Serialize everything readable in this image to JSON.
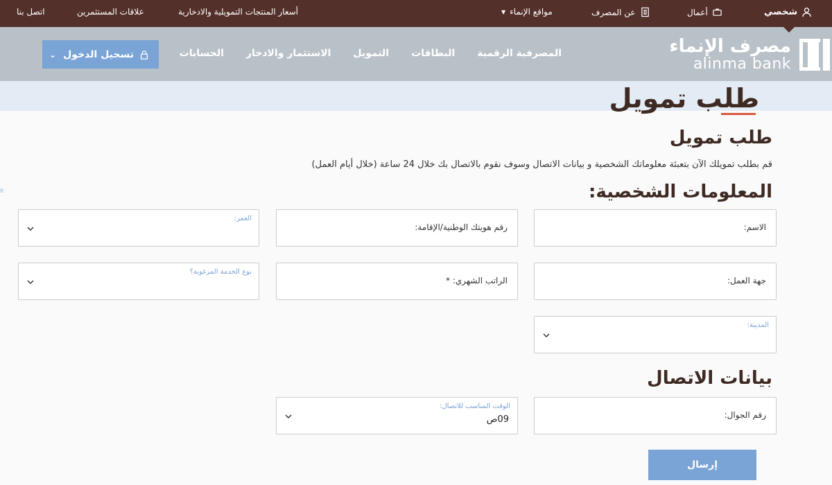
{
  "topbar": {
    "personal": "شخصي",
    "business": "أعمال",
    "about": "عن المصرف",
    "locations": "مواقع الإنماء",
    "prices": "أسعار المنتجات التمويلية والادخارية",
    "investors": "علاقات المستثمرين",
    "contact": "اتصل بنا"
  },
  "logo": {
    "arabic": "مصرف الإنماء",
    "english": "alinma bank"
  },
  "nav": {
    "accounts": "الحسابات",
    "investment": "الاستثمار والادخار",
    "financing": "التمويل",
    "cards": "البطاقات",
    "digital": "المصرفية الرقمية"
  },
  "login": {
    "label": "تسجيل الدخول"
  },
  "page": {
    "title": "طلب تمويل",
    "section_title": "طلب تمويل",
    "intro": "قم بطلب تمويلك الآن بتعبئة معلوماتك الشخصية و بيانات الاتصال وسوف نقوم بالاتصال بك خلال 24 ساعة (خلال أيام العمل)",
    "personal_info": "المعلومات الشخصية:",
    "contact_info": "بيانات الاتصال"
  },
  "fields": {
    "name": "الاسم:",
    "national_id": "رقم هويتك الوطنية/الإقامة:",
    "age": "العمر:",
    "employer": "جهة العمل:",
    "salary": "الراتب الشهري: *",
    "service": "نوع الخدمة المرغوبة؟",
    "city": "المدينة:",
    "mobile": "رقم الجوال:",
    "best_time_label": "الوقت المناسب للاتصال:",
    "best_time_value": "09ص"
  },
  "submit": {
    "label": "إرسال"
  },
  "colors": {
    "topbar": "#54302a",
    "nav": "#b9c1c8",
    "accent": "#7aa3d6",
    "title": "#3e2a22",
    "underline": "#d85a3d"
  }
}
